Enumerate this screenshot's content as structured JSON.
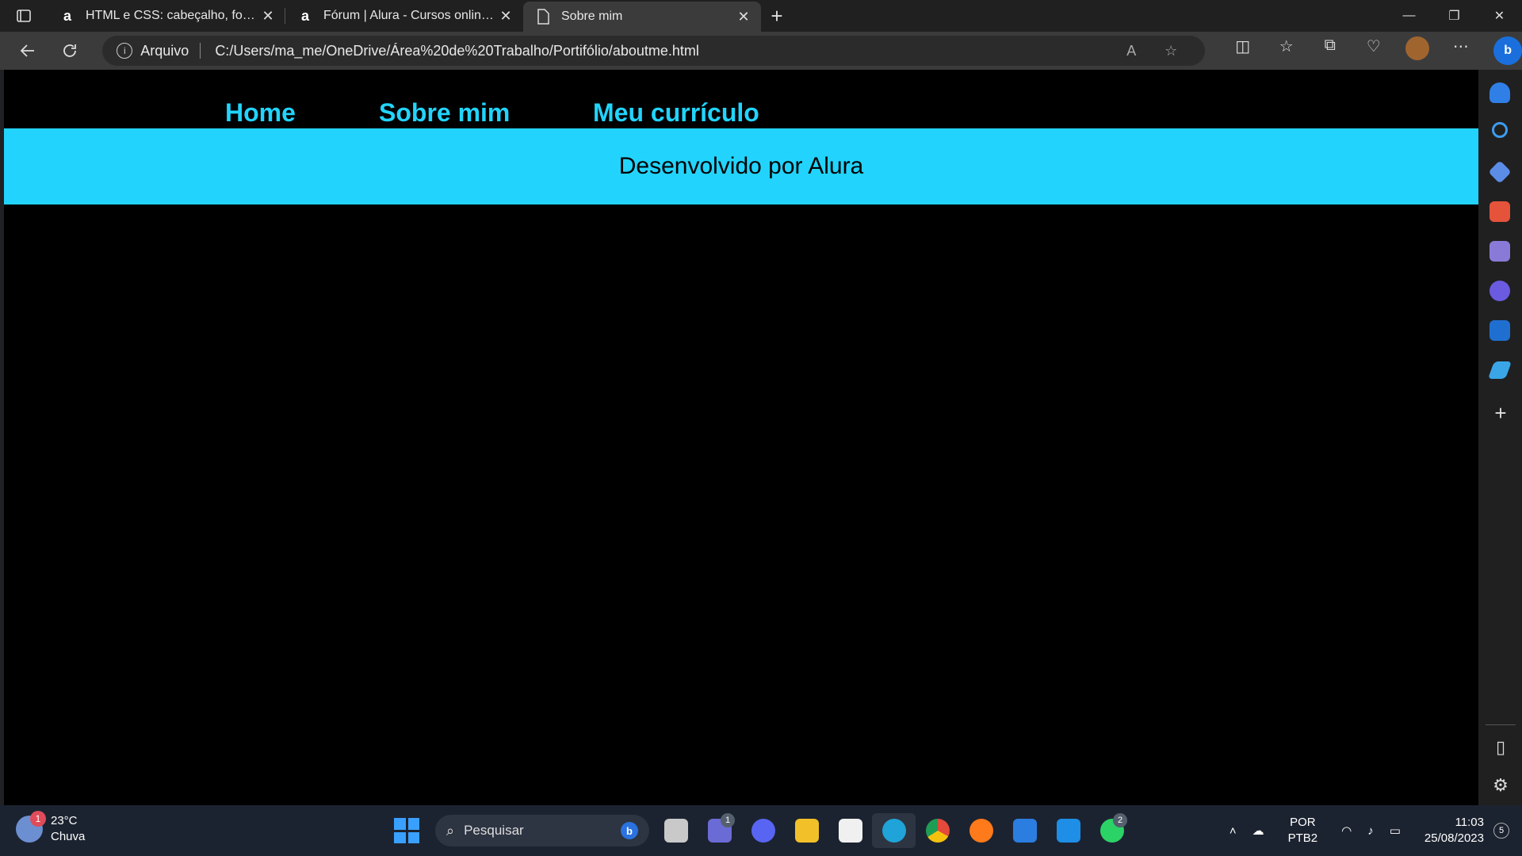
{
  "browser": {
    "tabs": [
      {
        "favicon": "a",
        "title": "HTML e CSS: cabeçalho, footer e",
        "close": "✕"
      },
      {
        "favicon": "a",
        "title": "Fórum | Alura - Cursos online de",
        "close": "✕"
      },
      {
        "favicon": "page-icon",
        "title": "Sobre mim",
        "close": "✕",
        "active": true
      }
    ],
    "new_tab": "+",
    "window_controls": {
      "minimize": "—",
      "restore": "❐",
      "close": "✕"
    },
    "address": {
      "security_label": "Arquivo",
      "url": "C:/Users/ma_me/OneDrive/Área%20de%20Trabalho/Portifólio/aboutme.html"
    },
    "copilot_label": "b"
  },
  "page": {
    "nav": [
      {
        "label": "Home"
      },
      {
        "label": "Sobre mim"
      },
      {
        "label": "Meu currículo"
      }
    ],
    "footer_text": "Desenvolvido por Alura",
    "accent": "#22d4fd",
    "background": "#000000"
  },
  "sidebar": {
    "icons": [
      "bell-icon",
      "search-icon",
      "tag-icon",
      "toolbox-icon",
      "chess-icon",
      "copilot-icon",
      "outlook-icon",
      "send-icon"
    ],
    "add": "+",
    "settings": "⚙"
  },
  "taskbar": {
    "weather": {
      "temp": "23°C",
      "condition": "Chuva",
      "badge": "1"
    },
    "search_placeholder": "Pesquisar",
    "search_bing": "b",
    "apps": [
      {
        "name": "file-manager-icon",
        "color": "#c9c9c9"
      },
      {
        "name": "teams-icon",
        "color": "#6b6bd6",
        "badge": "1"
      },
      {
        "name": "discord-icon",
        "color": "#5865f2"
      },
      {
        "name": "explorer-icon",
        "color": "#f2c029"
      },
      {
        "name": "store-icon",
        "color": "#f0f0f0"
      },
      {
        "name": "edge-icon",
        "color": "#1fa3d8",
        "active": true
      },
      {
        "name": "chrome-icon",
        "color": "#e34a3a"
      },
      {
        "name": "firefox-icon",
        "color": "#ff7a1a"
      },
      {
        "name": "mail-icon",
        "color": "#2b7de0"
      },
      {
        "name": "vscode-icon",
        "color": "#1e8ee6"
      },
      {
        "name": "whatsapp-icon",
        "color": "#2bd366",
        "badge": "2"
      }
    ],
    "tray": {
      "lang_top": "POR",
      "lang_bottom": "PTB2",
      "time": "11:03",
      "date": "25/08/2023",
      "notifications": "5"
    }
  }
}
